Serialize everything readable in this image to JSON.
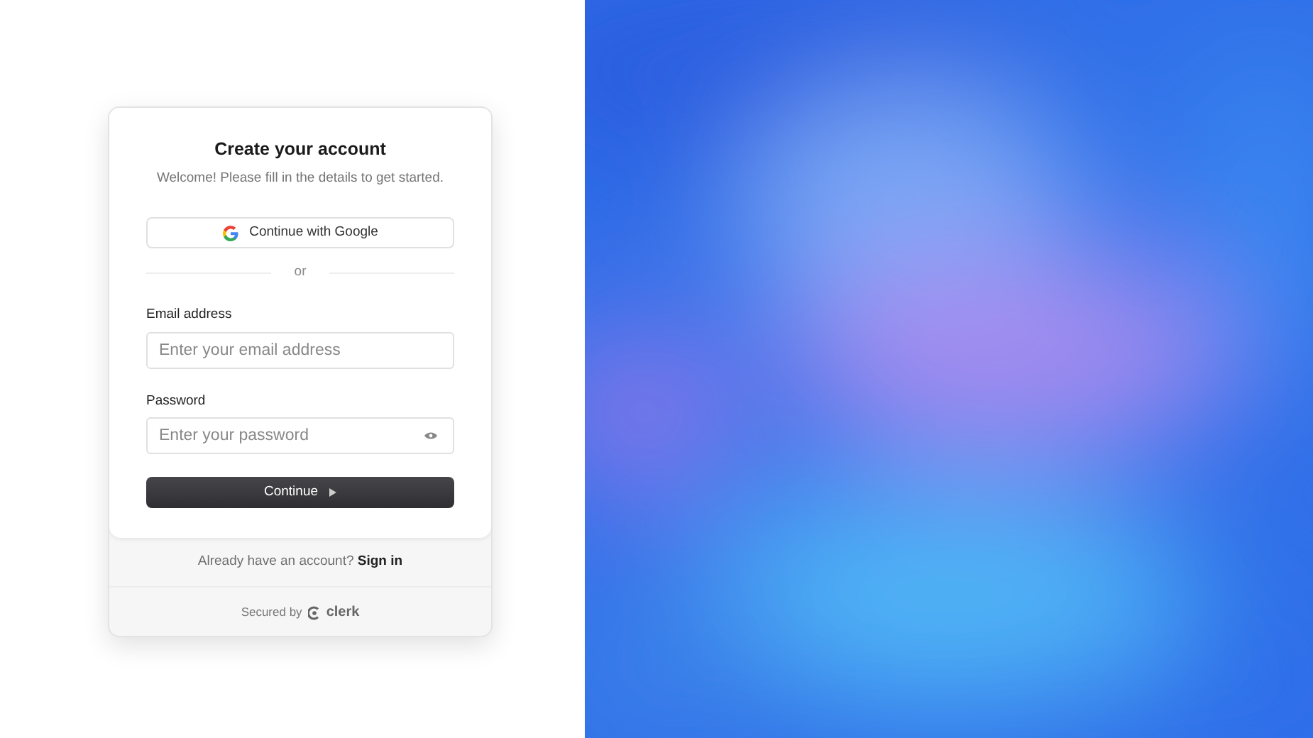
{
  "card": {
    "title": "Create your account",
    "subtitle": "Welcome! Please fill in the details to get started.",
    "social_button": "Continue with Google",
    "divider": "or",
    "fields": [
      {
        "label": "Email address",
        "placeholder": "Enter your email address",
        "kind": "email"
      },
      {
        "label": "Password",
        "placeholder": "Enter your password",
        "kind": "password"
      }
    ],
    "submit": "Continue"
  },
  "footer": {
    "prompt": "Already have an account?",
    "link": "Sign in",
    "secured_by": "Secured by",
    "brand": "clerk"
  }
}
